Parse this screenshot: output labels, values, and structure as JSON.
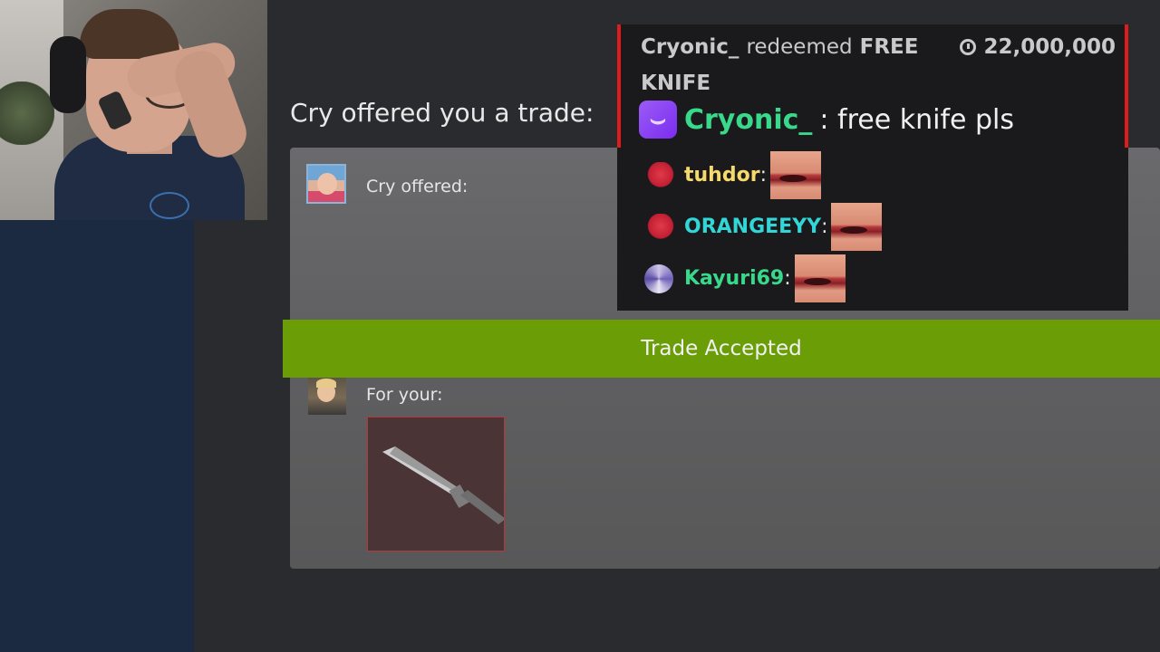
{
  "trade": {
    "heading": "Cry offered you a trade:",
    "offered_label": "Cry offered:",
    "for_your_label": "For your:",
    "status": "Trade Accepted",
    "item": "knife-icon"
  },
  "redemption": {
    "user": "Cryonic_",
    "action": "redeemed",
    "reward_prefix": "FREE",
    "reward_line2": "KNIFE",
    "cost": "22,000,000",
    "message_user": "Cryonic_",
    "message_text": ": free knife pls"
  },
  "chat": [
    {
      "user": "tuhdor",
      "color": "#f6d96b",
      "badge": "team-logo-icon"
    },
    {
      "user": "ORANGEEYY",
      "color": "#33d6d6",
      "badge": "team-logo-icon"
    },
    {
      "user": "Kayuri69",
      "color": "#38d98a",
      "badge": "team-logo-icon"
    }
  ],
  "colors": {
    "accept_green": "#6a9d06",
    "redeem_border": "#e01b1b",
    "sidebar": "#1b2a41"
  }
}
